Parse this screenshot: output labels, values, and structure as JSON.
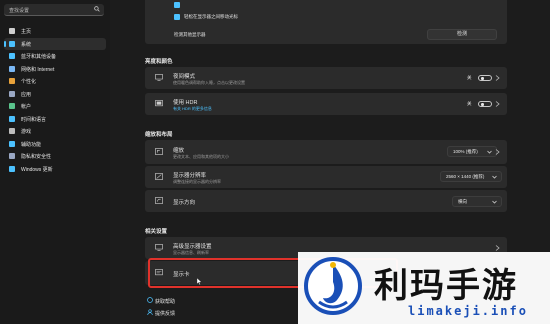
{
  "search": {
    "placeholder": "查找设置"
  },
  "sidebar": {
    "items": [
      {
        "label": "主页",
        "icon": "home-icon",
        "color": "#cfcfcf",
        "active": false
      },
      {
        "label": "系统",
        "icon": "system-icon",
        "color": "#4cc2ff",
        "active": true
      },
      {
        "label": "蓝牙和其他设备",
        "icon": "bluetooth-icon",
        "color": "#4cc2ff",
        "active": false
      },
      {
        "label": "网络和 Internet",
        "icon": "network-icon",
        "color": "#7ab8f5",
        "active": false
      },
      {
        "label": "个性化",
        "icon": "brush-icon",
        "color": "#e8a23a",
        "active": false
      },
      {
        "label": "应用",
        "icon": "apps-icon",
        "color": "#9aa8c4",
        "active": false
      },
      {
        "label": "帐户",
        "icon": "account-icon",
        "color": "#5ac48c",
        "active": false
      },
      {
        "label": "时间和语言",
        "icon": "time-language-icon",
        "color": "#4cc2ff",
        "active": false
      },
      {
        "label": "游戏",
        "icon": "gaming-icon",
        "color": "#bdbdbd",
        "active": false
      },
      {
        "label": "辅助功能",
        "icon": "accessibility-icon",
        "color": "#4cc2ff",
        "active": false
      },
      {
        "label": "隐私和安全性",
        "icon": "shield-icon",
        "color": "#9aa8c4",
        "active": false
      },
      {
        "label": "Windows 更新",
        "icon": "windows-update-icon",
        "color": "#4cc2ff",
        "active": false
      }
    ]
  },
  "multi_display": {
    "option1": "",
    "option2": "轻松在显示器之间移动光标",
    "detect_label": "检测其他显示器",
    "detect_button": "检测"
  },
  "brightness_color": {
    "section_title": "亮度和颜色",
    "night_light": {
      "title": "夜间模式",
      "subtitle": "使用暖色调帮助你入睡，点击以更改设置",
      "state": "关"
    },
    "hdr": {
      "title": "使用 HDR",
      "subtitle": "有关 HDR 的更多信息",
      "state": "关"
    }
  },
  "scale_layout": {
    "section_title": "缩放和布局",
    "scale": {
      "title": "缩放",
      "subtitle": "更改文本、应用和其他项的大小",
      "value": "100% (推荐)"
    },
    "resolution": {
      "title": "显示器分辨率",
      "subtitle": "调整连接的显示器的分辨率",
      "value": "2560 × 1440 (推荐)"
    },
    "orientation": {
      "title": "显示方向",
      "value": "横向"
    }
  },
  "related": {
    "section_title": "相关设置",
    "advanced": {
      "title": "高级显示器设置",
      "subtitle": "显示器信息、刷新率"
    },
    "graphics": {
      "title": "显示卡"
    }
  },
  "footer": {
    "help": "获取帮助",
    "feedback": "提供反馈"
  },
  "watermark": {
    "title": "利玛手游",
    "url": "limakeji.info"
  },
  "colors": {
    "accent": "#4cc2ff",
    "highlight": "#e0322b"
  }
}
